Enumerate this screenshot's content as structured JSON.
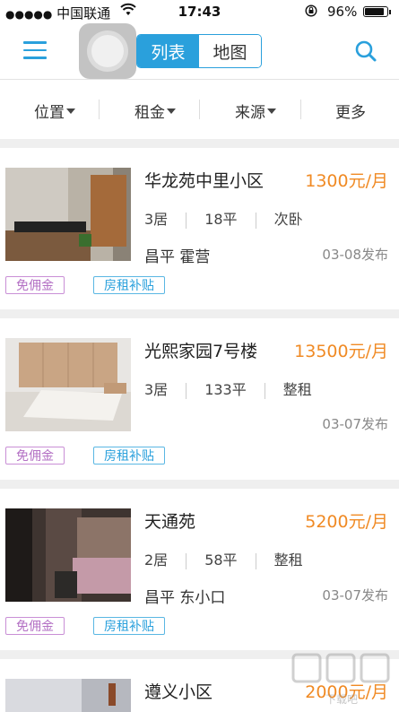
{
  "status_bar": {
    "dots": "●●●●●",
    "carrier": "中国联通",
    "time": "17:43",
    "battery": "96%",
    "battery_level": 0.96
  },
  "nav": {
    "tabs": [
      {
        "label": "列表",
        "active": true
      },
      {
        "label": "地图",
        "active": false
      }
    ],
    "icons": [
      "menu-icon",
      "search-icon"
    ]
  },
  "filters": [
    {
      "label": "位置",
      "has_caret": true
    },
    {
      "label": "租金",
      "has_caret": true
    },
    {
      "label": "来源",
      "has_caret": true
    },
    {
      "label": "更多",
      "has_caret": false
    }
  ],
  "colors": {
    "accent": "#2aa0dc",
    "price": "#f08a24",
    "tag_purple": "#b370c4"
  },
  "listings": [
    {
      "title": "华龙苑中里小区",
      "price": "1300元/月",
      "rooms": "3居",
      "area": "18平",
      "type": "次卧",
      "location": "昌平 霍营",
      "date": "03-08发布",
      "tags": [
        "免佣金",
        "房租补贴"
      ]
    },
    {
      "title": "光熙家园7号楼",
      "price": "13500元/月",
      "rooms": "3居",
      "area": "133平",
      "type": "整租",
      "location": "",
      "date": "03-07发布",
      "tags": [
        "免佣金",
        "房租补贴"
      ]
    },
    {
      "title": "天通苑",
      "price": "5200元/月",
      "rooms": "2居",
      "area": "58平",
      "type": "整租",
      "location": "昌平 东小口",
      "date": "03-07发布",
      "tags": [
        "免佣金",
        "房租补贴"
      ]
    },
    {
      "title": "遵义小区",
      "price": "2000元/月"
    }
  ],
  "watermark": "下载吧"
}
